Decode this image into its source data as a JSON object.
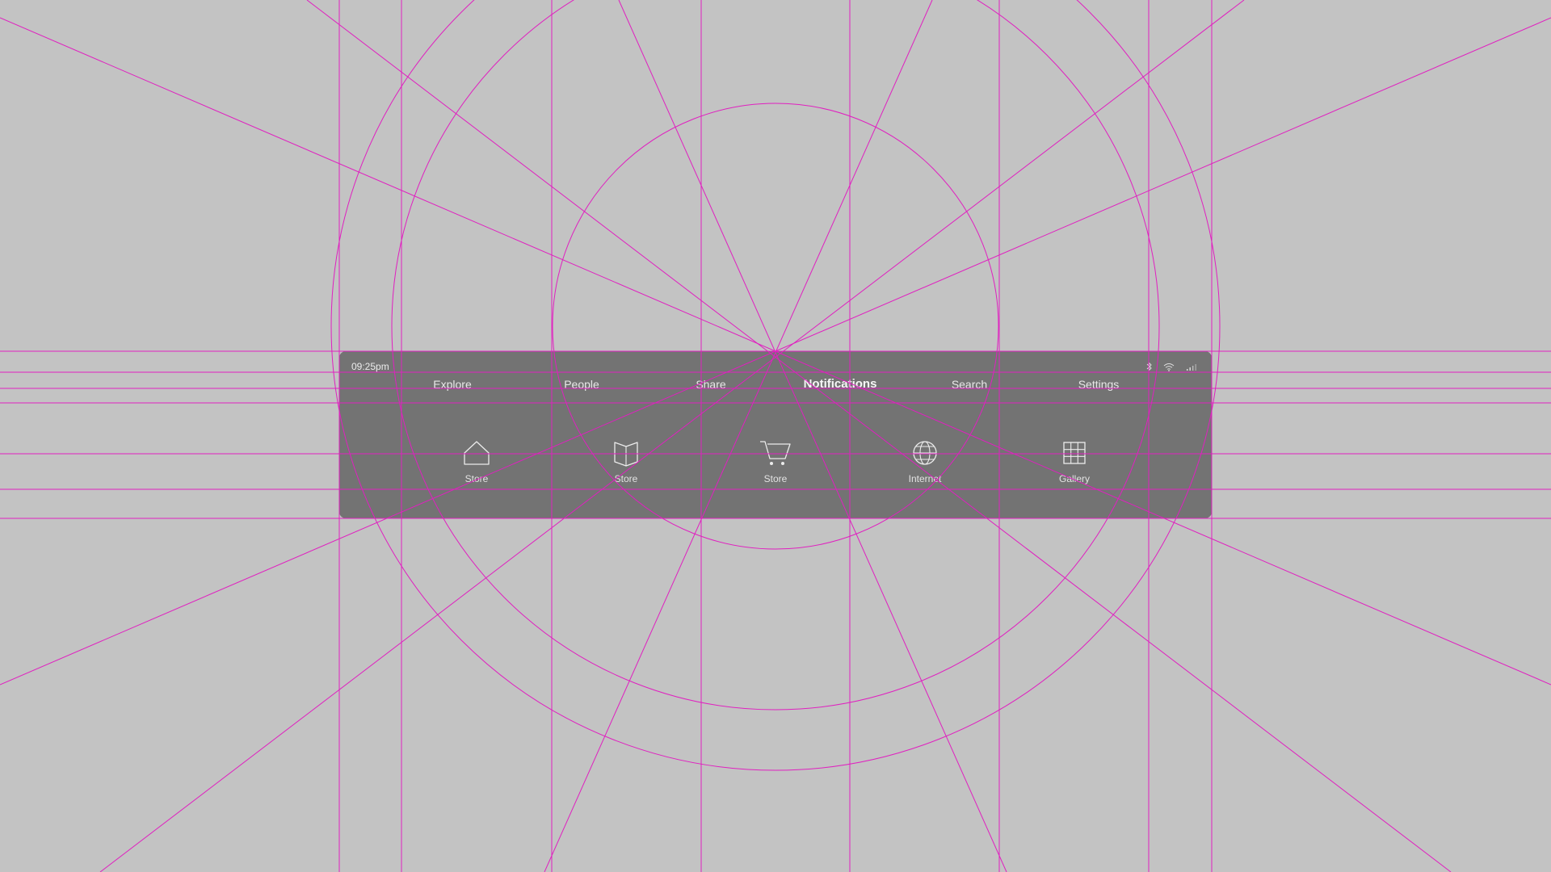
{
  "status_bar": {
    "time": "09:25pm",
    "icons": [
      "bluetooth-icon",
      "wifi-icon",
      "signal-icon"
    ]
  },
  "tabs": [
    {
      "label": "Explore",
      "active": false
    },
    {
      "label": "People",
      "active": false
    },
    {
      "label": "Share",
      "active": false
    },
    {
      "label": "Notifications",
      "active": true
    },
    {
      "label": "Search",
      "active": false
    },
    {
      "label": "Settings",
      "active": false
    }
  ],
  "apps": [
    {
      "label": "Store",
      "icon": "home-icon"
    },
    {
      "label": "Store",
      "icon": "book-icon"
    },
    {
      "label": "Store",
      "icon": "cart-icon"
    },
    {
      "label": "Internet",
      "icon": "globe-icon"
    },
    {
      "label": "Gallery",
      "icon": "grid-icon"
    }
  ],
  "colors": {
    "background": "#c3c3c3",
    "panel": "#737373",
    "guide_lines": "#e020c0",
    "text": "#e8e8e8"
  }
}
